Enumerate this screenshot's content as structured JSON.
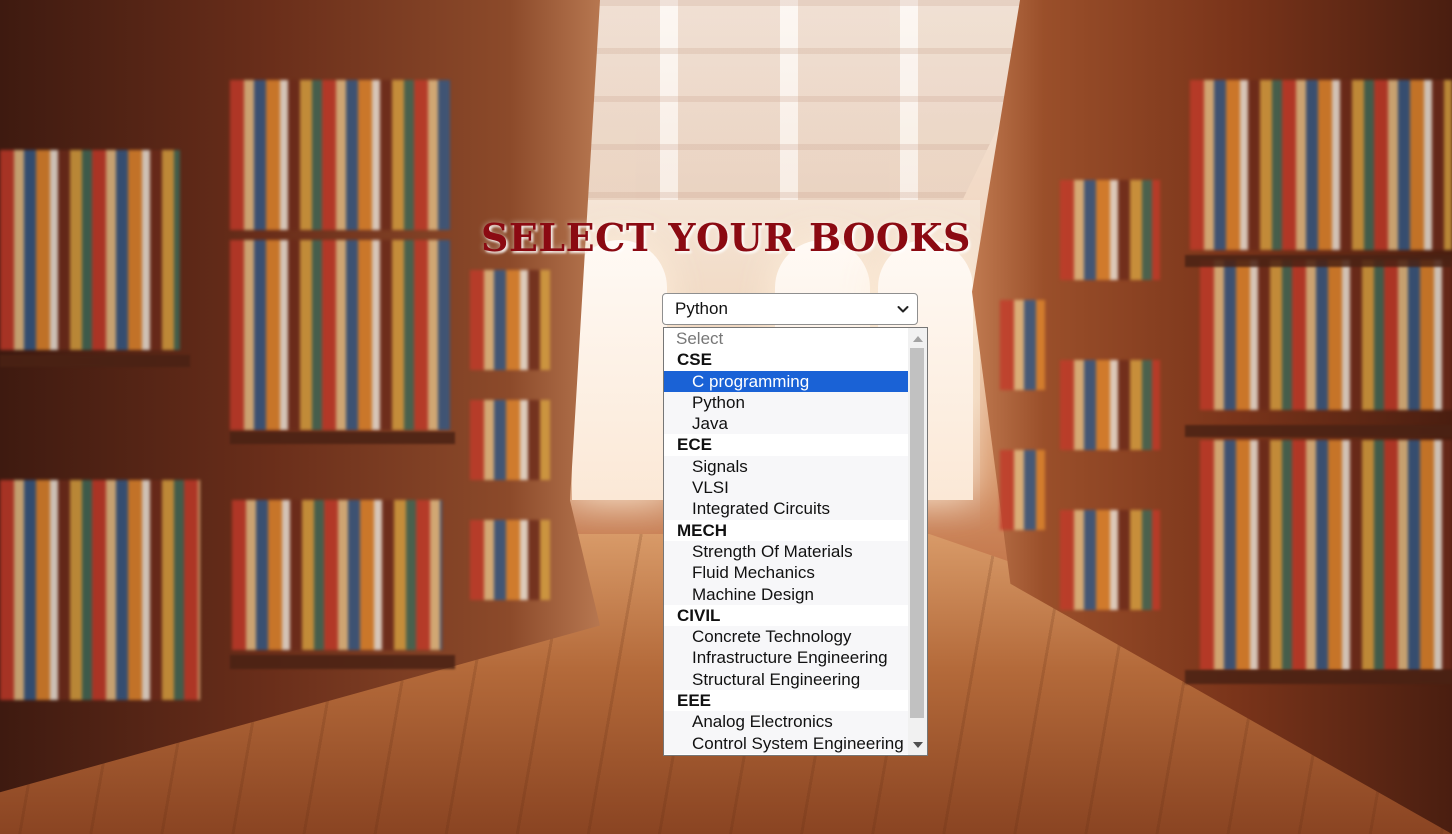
{
  "page": {
    "title": "SELECT YOUR BOOKS"
  },
  "select": {
    "current_value": "Python",
    "chevron_icon": "chevron-down-icon"
  },
  "dropdown": {
    "placeholder": "Select",
    "highlighted": "C programming",
    "groups": [
      {
        "label": "CSE",
        "items": [
          "C programming",
          "Python",
          "Java"
        ]
      },
      {
        "label": "ECE",
        "items": [
          "Signals",
          "VLSI",
          "Integrated Circuits"
        ]
      },
      {
        "label": "MECH",
        "items": [
          "Strength Of Materials",
          "Fluid Mechanics",
          "Machine Design"
        ]
      },
      {
        "label": "CIVIL",
        "items": [
          "Concrete Technology",
          "Infrastructure Engineering",
          "Structural Engineering"
        ]
      },
      {
        "label": "EEE",
        "items": [
          "Analog Electronics",
          "Control System Engineering"
        ]
      }
    ],
    "scrollbar": {
      "up_icon": "scroll-up-arrow-icon",
      "down_icon": "scroll-down-arrow-icon"
    }
  },
  "colors": {
    "title": "#8b0a12",
    "highlight": "#1a62d6"
  }
}
